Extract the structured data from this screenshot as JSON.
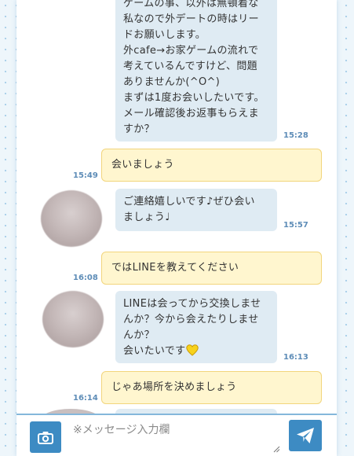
{
  "messages": [
    {
      "direction": "in",
      "text": "ゲームの事、以外は無頓着な\n私なので外デートの時はリー\nドお願いします。\n外cafe→お家ゲームの流れで\n考えているんですけど、問題\nありませんか(^O^)\nまずは1度お会いしたいです。\nメール確認後お返事もらえま\nすか？",
      "time": "15:28"
    },
    {
      "direction": "out",
      "text": "会いましょう",
      "time": "15:49"
    },
    {
      "direction": "in",
      "text": "ご連絡嬉しいです♪ぜひ会い\nましょう♩",
      "time": "15:57"
    },
    {
      "direction": "out",
      "text": "ではLINEを教えてください",
      "time": "16:08"
    },
    {
      "direction": "in",
      "text": "LINEは会ってから交換しませ\nんか？今から会えたりしませ\nんか？\n会いたいです",
      "time": "16:13"
    },
    {
      "direction": "out",
      "text": "じゃあ場所を決めましょう",
      "time": "16:14"
    }
  ],
  "icons": {
    "camera": "camera-icon",
    "send": "paper-plane-icon",
    "heart": "yellow-heart-emoji"
  },
  "colors": {
    "accent": "#3d8bc3",
    "incoming_bubble": "#dfebf3",
    "outgoing_bubble": "#fff6cf",
    "outgoing_border": "#f2d57c",
    "time": "#5d8cb7"
  },
  "composer": {
    "placeholder": "※メッセージ入力欄",
    "value": ""
  }
}
